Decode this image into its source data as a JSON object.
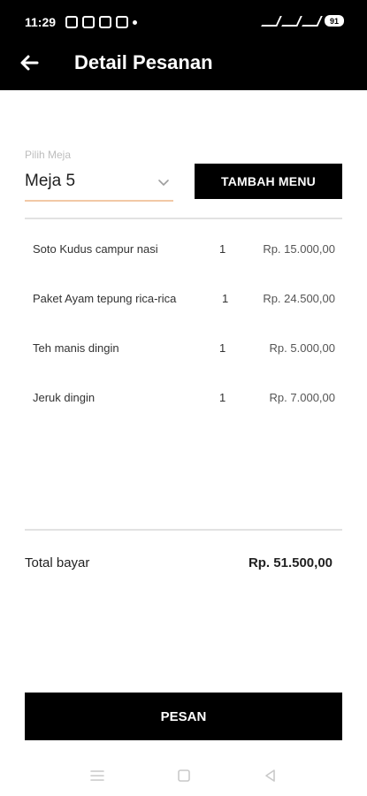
{
  "status_bar": {
    "time": "11:29",
    "battery": "91"
  },
  "app_bar": {
    "title": "Detail Pesanan"
  },
  "table_select": {
    "label": "Pilih Meja",
    "value": "Meja 5"
  },
  "buttons": {
    "add_menu": "TAMBAH MENU",
    "order": "PESAN"
  },
  "order_items": [
    {
      "name": "Soto Kudus campur nasi",
      "qty": "1",
      "price": "Rp. 15.000,00"
    },
    {
      "name": "Paket Ayam tepung rica-rica",
      "qty": "1",
      "price": "Rp. 24.500,00"
    },
    {
      "name": "Teh manis dingin",
      "qty": "1",
      "price": "Rp. 5.000,00"
    },
    {
      "name": "Jeruk dingin",
      "qty": "1",
      "price": "Rp. 7.000,00"
    }
  ],
  "total": {
    "label": "Total bayar",
    "value": "Rp. 51.500,00"
  },
  "colors": {
    "header_bg": "#000000",
    "button_bg": "#000000",
    "select_underline": "#f2c9a6"
  },
  "icons": {
    "back": "arrow-left-icon",
    "dropdown": "chevron-down-icon",
    "nav_menu": "menu-icon",
    "nav_home": "square-home-icon",
    "nav_back": "triangle-back-icon"
  }
}
